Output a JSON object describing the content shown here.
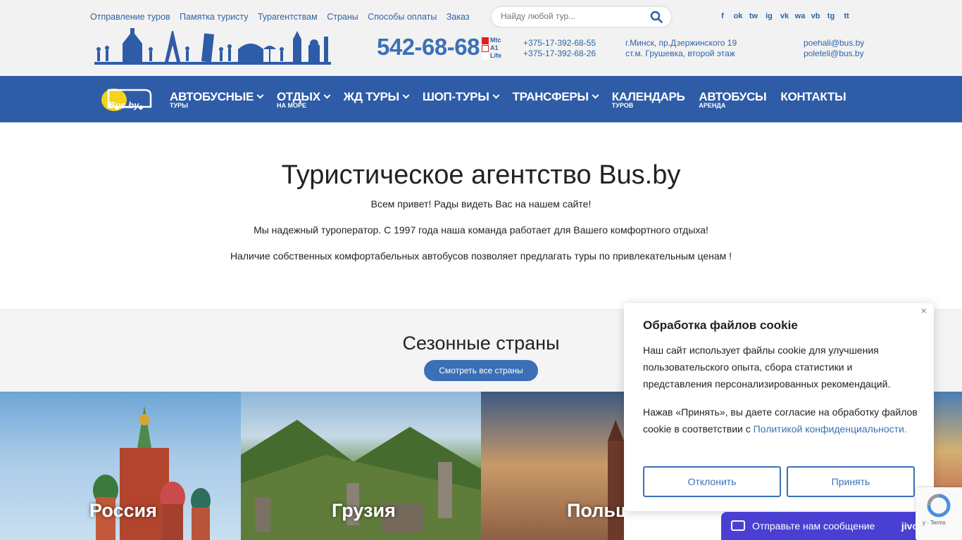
{
  "top_links": [
    "Отправление туров",
    "Памятка туристу",
    "Турагентствам",
    "Страны",
    "Способы оплаты",
    "Заказ автобуса"
  ],
  "search": {
    "placeholder": "Найду любой тур..."
  },
  "social": [
    "f",
    "ok",
    "tw",
    "ig",
    "vk",
    "wa",
    "vb",
    "tg",
    "tt"
  ],
  "phone": {
    "main": "542-68-68",
    "operators": [
      "Mtc",
      "A1",
      "Life"
    ],
    "lines": [
      "+375-17-392-68-55",
      "+375-17-392-68-26"
    ]
  },
  "address": [
    "г.Минск, пр.Дзержинского 19",
    "ст.м. Грушевка, второй этаж"
  ],
  "emails": [
    "poehali@bus.by",
    "poleteli@bus.by"
  ],
  "logo_text": "Bus.by",
  "nav": [
    {
      "label": "АВТОБУСНЫЕ",
      "sub": "ТУРЫ",
      "chevron": true
    },
    {
      "label": "ОТДЫХ",
      "sub": "НА МОРЕ",
      "chevron": true
    },
    {
      "label": "ЖД ТУРЫ",
      "sub": "",
      "chevron": true
    },
    {
      "label": "ШОП-ТУРЫ",
      "sub": "",
      "chevron": true
    },
    {
      "label": "ТРАНСФЕРЫ",
      "sub": "",
      "chevron": true
    },
    {
      "label": "КАЛЕНДАРЬ",
      "sub": "ТУРОВ",
      "chevron": false
    },
    {
      "label": "АВТОБУСЫ",
      "sub": "АРЕНДА",
      "chevron": false
    },
    {
      "label": "КОНТАКТЫ",
      "sub": "",
      "chevron": false
    }
  ],
  "hero": {
    "title": "Туристическое агентство Bus.by",
    "p1": "Всем привет! Рады видеть Вас на нашем сайте!",
    "p2": "Мы надежный туроператор. С 1997 года наша команда работает для Вашего комфортного отдыха!",
    "p3": "Наличие собственных комфортабельных автобусов позволяет предлагать туры по привлекательным ценам !"
  },
  "season": {
    "title": "Сезонные страны",
    "button": "Смотреть все страны"
  },
  "countries": [
    "Россия",
    "Грузия",
    "Польша"
  ],
  "cookie": {
    "close": "×",
    "title": "Обработка файлов cookie",
    "text1": "Наш сайт использует файлы cookie для улучшения пользовательского опыта, сбора статистики и представления персонализированных рекомендаций.",
    "text2": "Нажав «Принять», вы даете согласие на обработку файлов cookie в соответствии с ",
    "link": "Политикой конфиденциальности.",
    "decline": "Отклонить",
    "accept": "Принять"
  },
  "jivo": {
    "text": "Отправьте нам сообщение",
    "brand": "jivo"
  },
  "recaptcha": "y · Terms",
  "colors": {
    "brand": "#2e5ca7",
    "accent": "#3b70b6",
    "jivo": "#4a3fd3"
  }
}
